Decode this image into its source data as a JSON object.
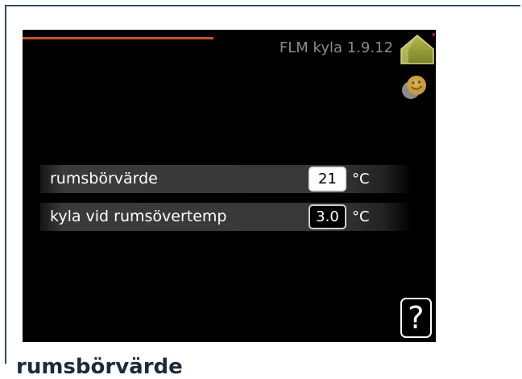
{
  "page": {
    "section_heading": "rumsbörvärde"
  },
  "display": {
    "title": "FLM kyla 1.9.12",
    "home_icon": "house-icon",
    "status_icon": "smiley-icon",
    "help": {
      "icon": "help-icon",
      "glyph": "?"
    },
    "rows": [
      {
        "label": "rumsbörvärde",
        "value": "21",
        "unit": "°C",
        "selected": true
      },
      {
        "label": "kyla vid rumsövertemp",
        "value": "3.0",
        "unit": "°C",
        "selected": false
      }
    ]
  },
  "colors": {
    "frame_border": "#2f4d6b",
    "screen_background": "#000000",
    "accent_line": "#c2561f",
    "title_text": "#8a8a8a",
    "label_text": "#ffffff",
    "selected_value_background": "#ffffff",
    "heading_text": "#1c2b3a",
    "home_icon": "#8e9b35",
    "status_icon": "#c99d3e"
  }
}
